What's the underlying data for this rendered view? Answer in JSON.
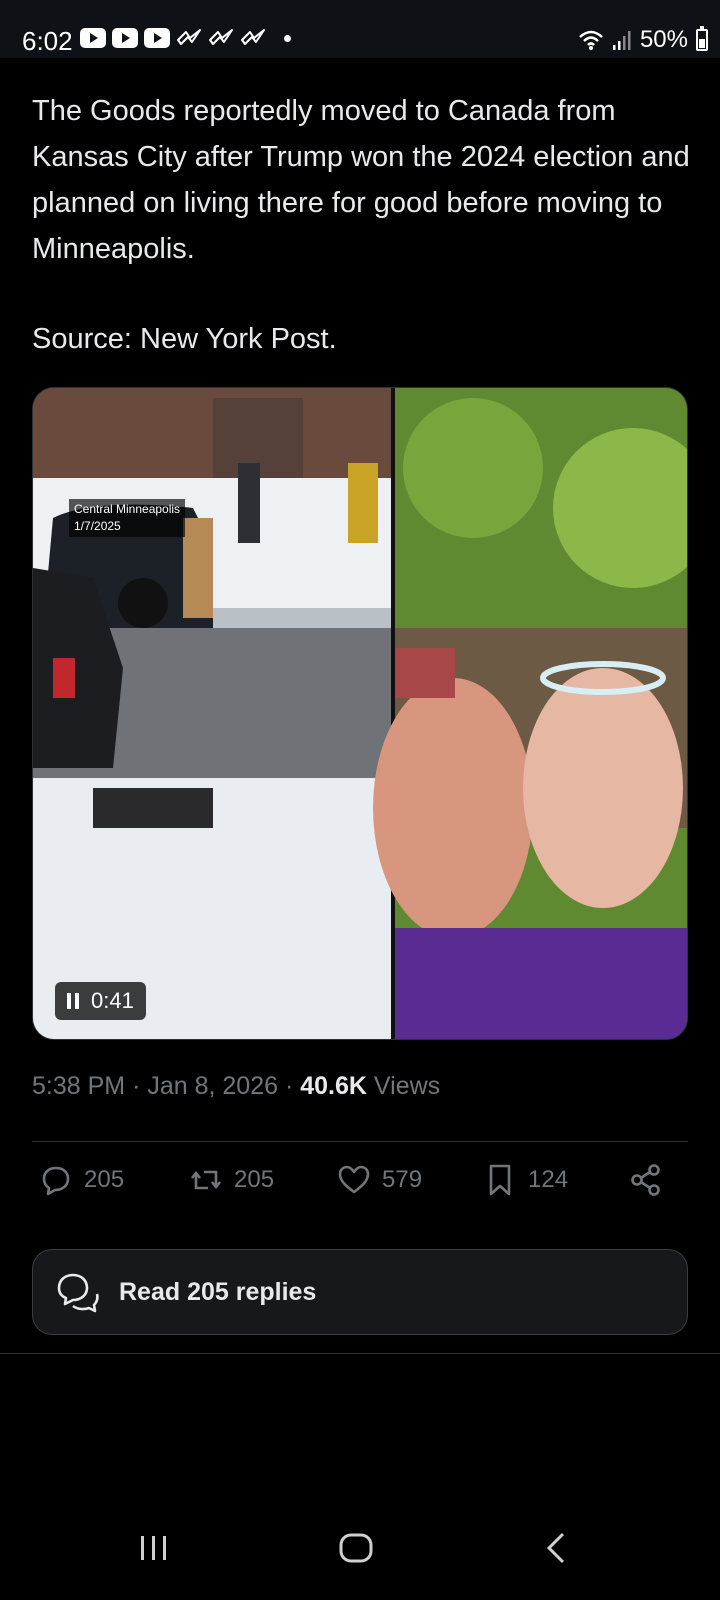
{
  "status_bar": {
    "time": "6:02",
    "battery_percent": "50%",
    "left_icons": [
      "youtube-icon",
      "youtube-icon",
      "youtube-icon",
      "bird-icon",
      "bird-icon",
      "bird-icon",
      "dot-icon"
    ],
    "right_icons": [
      "wifi-icon",
      "signal-icon",
      "battery-icon"
    ]
  },
  "tweet": {
    "text": "The Goods reportedly moved to Canada from Kansas City after Trump won the 2024 election and planned on living there for good before moving to Minneapolis.",
    "source": "Source: New York Post.",
    "media": {
      "overlay_location": "Central Minneapolis",
      "overlay_date": "1/7/2025",
      "video_duration": "0:41",
      "video_state": "pause-icon"
    },
    "time": "5:38 PM",
    "separator": "·",
    "date": "Jan 8, 2026",
    "views_count": "40.6K",
    "views_label": "Views"
  },
  "actions": {
    "replies": "205",
    "reposts": "205",
    "likes": "579",
    "bookmarks": "124"
  },
  "read_replies_label": "Read 205 replies",
  "colors": {
    "background": "#000000",
    "text_primary": "#e7e9ea",
    "text_secondary": "#71767b",
    "border": "#2f3336"
  }
}
